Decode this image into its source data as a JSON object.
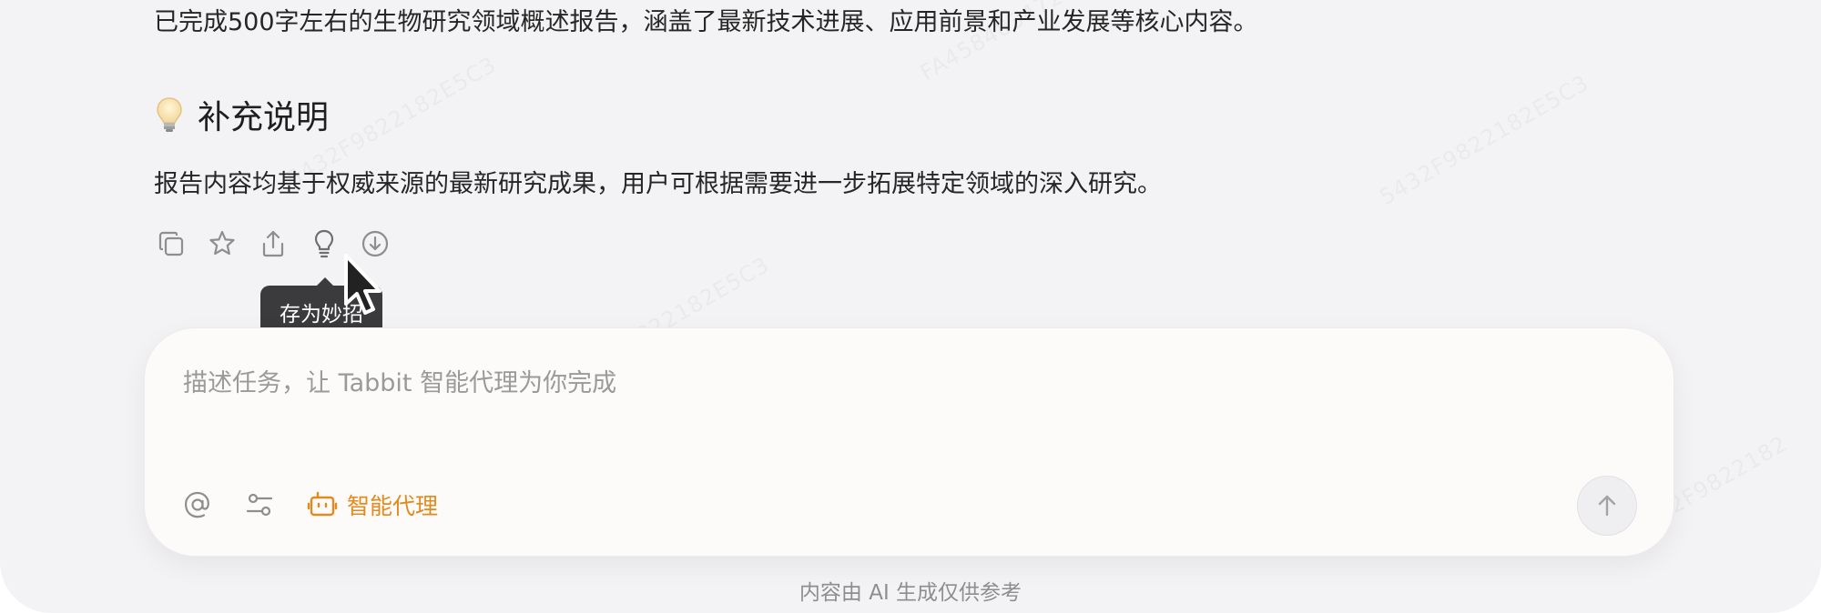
{
  "content": {
    "summary_line": "已完成500字左右的生物研究领域概述报告，涵盖了最新技术进展、应用前景和产业发展等核心内容。",
    "section_title": "补充说明",
    "section_body": "报告内容均基于权威来源的最新研究成果，用户可根据需要进一步拓展特定领域的深入研究。"
  },
  "actions": {
    "icons": [
      "copy-icon",
      "star-icon",
      "share-icon",
      "lightbulb-icon",
      "download-icon"
    ],
    "tooltip": "存为妙招"
  },
  "composer": {
    "placeholder": "描述任务，让 Tabbit 智能代理为你完成",
    "value": "",
    "mention_icon": "at-icon",
    "settings_icon": "sliders-icon",
    "agent_label": "智能代理",
    "agent_color": "#e38a1f",
    "send_icon": "arrow-up-icon"
  },
  "footer": {
    "note": "内容由 AI 生成仅供参考"
  },
  "watermark": "5432F9822182E5C3FA45848347233"
}
